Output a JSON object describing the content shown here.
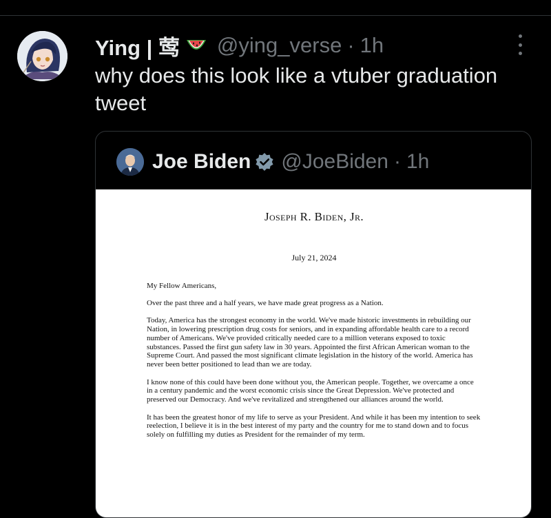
{
  "post": {
    "author_name": "Ying | 莺",
    "author_emoji": "watermelon-icon",
    "handle": "@ying_verse",
    "separator": "·",
    "time": "1h",
    "text": "why does this look like a vtuber graduation tweet"
  },
  "quoted": {
    "author_name": "Joe Biden",
    "verified_icon": "verified-badge-icon",
    "handle": "@JoeBiden",
    "separator": "·",
    "time": "1h",
    "letter": {
      "heading": "Joseph R. Biden, Jr.",
      "date": "July 21, 2024",
      "salutation": "My Fellow Americans,",
      "paragraphs": [
        "Over the past three and a half years, we have made great progress as a Nation.",
        "Today, America has the strongest economy in the world. We've made historic investments in rebuilding our Nation, in lowering prescription drug costs for seniors, and in expanding affordable health care to a record number of Americans. We've provided critically needed care to a million veterans exposed to toxic substances. Passed the first gun safety law in 30 years. Appointed the first African American woman to the Supreme Court. And passed the most significant climate legislation in the history of the world. America has never been better positioned to lead than we are today.",
        "I know none of this could have been done without you, the American people. Together, we overcame a once in a century pandemic and the worst economic crisis since the Great Depression. We've protected and preserved our Democracy. And we've revitalized and strengthened our alliances around the world.",
        "It has been the greatest honor of my life to serve as your President. And while it has been my intention to seek reelection, I believe it is in the best interest of my party and the country for me to stand down and to focus solely on fulfilling my duties as President for the remainder of my term."
      ]
    }
  },
  "colors": {
    "background": "#000000",
    "text_primary": "#e7e9ea",
    "text_secondary": "#71767b",
    "border": "#2f3336",
    "verified": "#829aab"
  }
}
